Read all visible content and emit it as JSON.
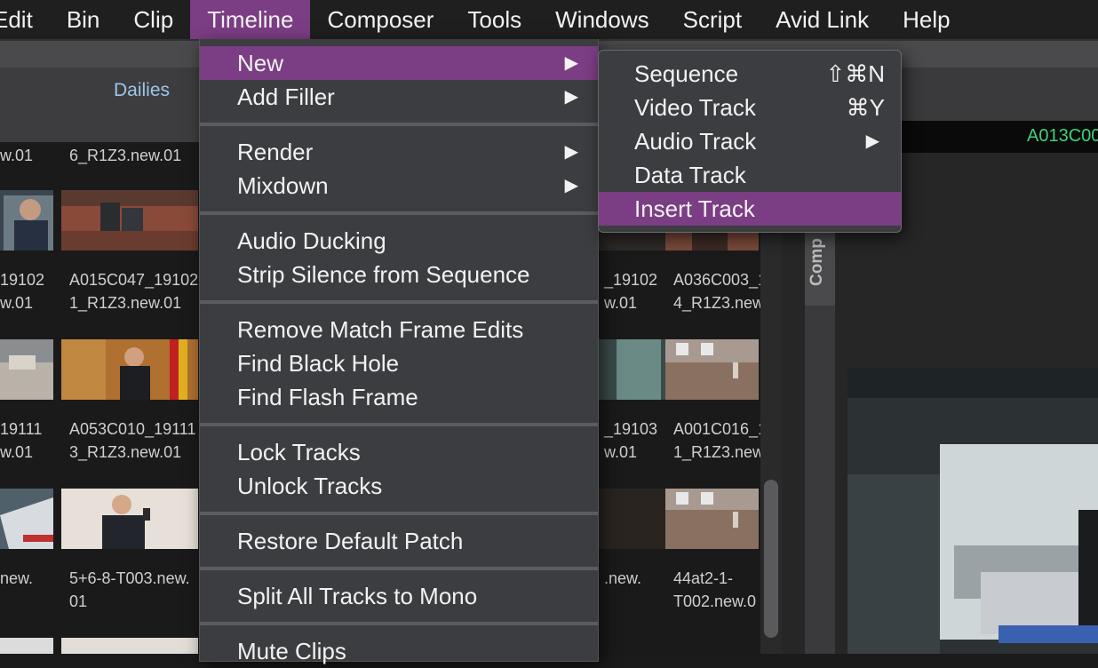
{
  "menubar": {
    "items": [
      "Edit",
      "Bin",
      "Clip",
      "Timeline",
      "Composer",
      "Tools",
      "Windows",
      "Script",
      "Avid Link",
      "Help"
    ],
    "active": "Timeline"
  },
  "bin": {
    "title": "Dailies",
    "clips_row0": [
      "w.01",
      "6_R1Z3.new.01"
    ],
    "clips_row1": [
      "19102\nw.01",
      "A015C047_19102\n1_R1Z3.new.01",
      "_19102\nw.01",
      "A036C003_1\n4_R1Z3.new"
    ],
    "clips_row2": [
      "19111\nw.01",
      "A053C010_19111\n3_R1Z3.new.01",
      "_19103\nw.01",
      "A001C016_1\n1_R1Z3.new"
    ],
    "clips_row3": [
      "new.",
      "5+6-8-T003.new.\n01",
      ".new.",
      "44at2-1-\nT002.new.0"
    ]
  },
  "composer": {
    "timecode": "A013C00",
    "side_tab": "Comp"
  },
  "timeline_menu": {
    "new": "New",
    "add_filler": "Add Filler",
    "render": "Render",
    "mixdown": "Mixdown",
    "audio_ducking": "Audio Ducking",
    "strip_silence": "Strip Silence from Sequence",
    "remove_match_frame": "Remove Match Frame Edits",
    "find_black_hole": "Find Black Hole",
    "find_flash_frame": "Find Flash Frame",
    "lock_tracks": "Lock Tracks",
    "unlock_tracks": "Unlock Tracks",
    "restore_default_patch": "Restore Default Patch",
    "split_tracks_mono": "Split All Tracks to Mono",
    "mute_clips": "Mute Clips"
  },
  "new_submenu": {
    "sequence": "Sequence",
    "sequence_shortcut": "⇧⌘N",
    "video_track": "Video Track",
    "video_track_shortcut": "⌘Y",
    "audio_track": "Audio Track",
    "data_track": "Data Track",
    "insert_track": "Insert Track"
  },
  "colors": {
    "highlight": "#7b3d83",
    "menu_bg": "#3c3d40",
    "bin_title": "#9ec5e8",
    "timecode": "#3fd07a"
  }
}
